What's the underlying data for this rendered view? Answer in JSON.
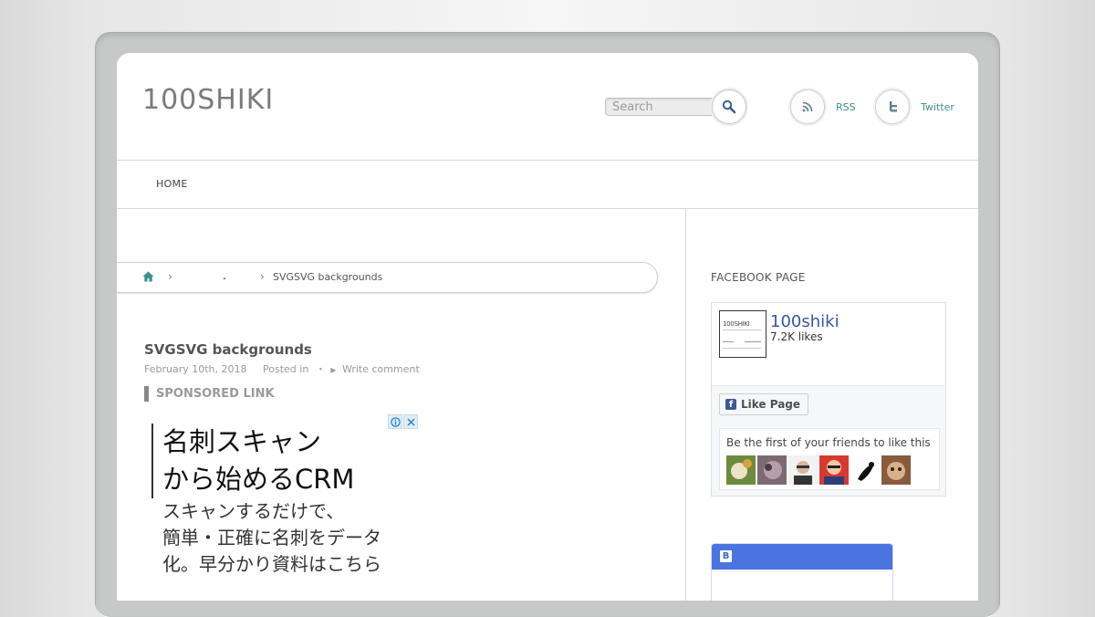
{
  "site": {
    "title": "100SHIKI"
  },
  "search": {
    "placeholder": "Search"
  },
  "social": {
    "rss_label": "RSS",
    "twitter_label": "Twitter"
  },
  "nav": {
    "home": "HOME"
  },
  "breadcrumb": {
    "separator": "›",
    "category": "・",
    "current": "SVGSVG backgrounds"
  },
  "post": {
    "title": "SVGSVG backgrounds",
    "date": "February 10th, 2018",
    "posted_in": "Posted in",
    "category": "・",
    "comment_link": "Write comment"
  },
  "sponsored": {
    "label": "SPONSORED LINK"
  },
  "ad": {
    "headline": [
      "名刺スキャン",
      "から始めるCRM"
    ],
    "body": [
      "スキャンするだけで、",
      "簡単・正確に名刺をデータ",
      "化。早分かり資料はこちら"
    ]
  },
  "sidebar": {
    "facebook_title": "FACEBOOK PAGE",
    "fb_page_name": "100shiki",
    "fb_likes": "7.2K likes",
    "fb_like_button": "Like Page",
    "fb_friends_text": "Be the first of your friends to like this",
    "fb_thumb_logo": "100SHIKI"
  },
  "colors": {
    "accent_teal": "#3f8f8f",
    "facebook_blue": "#3b5998",
    "hatena_blue": "#4a74e0"
  },
  "icons": {
    "search": "magnifier-icon",
    "rss": "rss-icon",
    "twitter": "twitter-icon",
    "home": "home-icon"
  }
}
